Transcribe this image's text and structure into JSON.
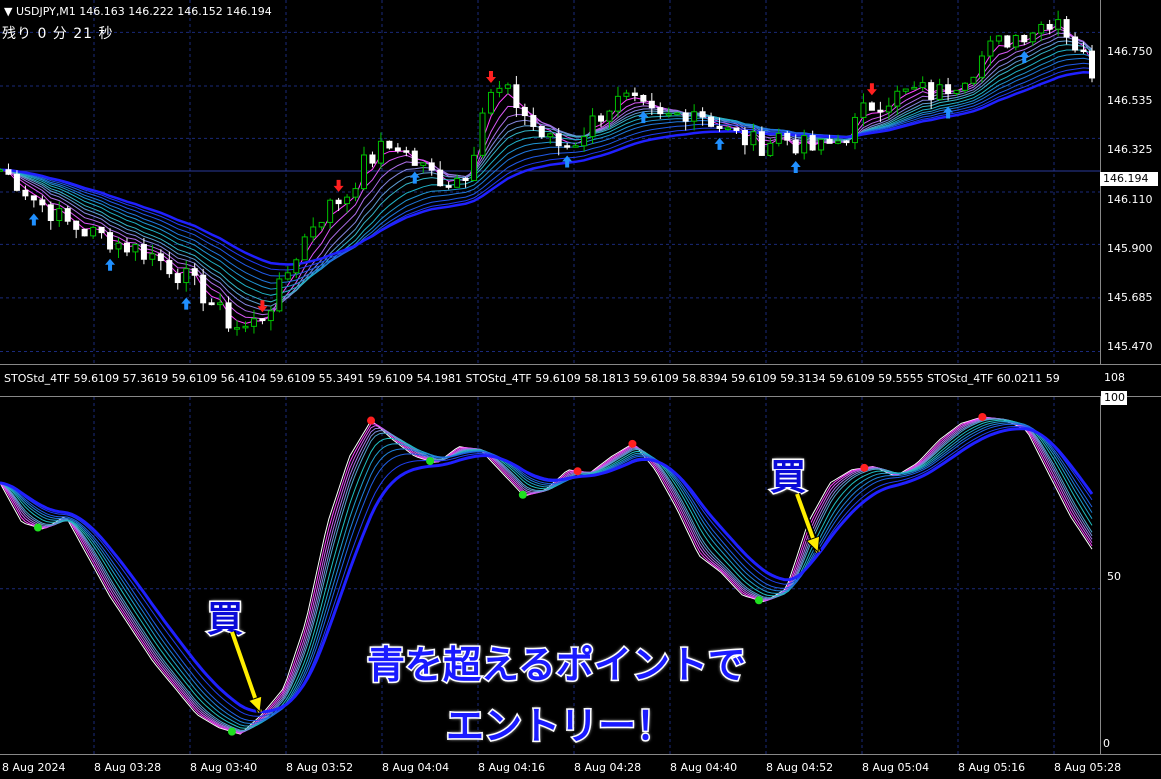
{
  "header": {
    "symbol_title": "▼ USDJPY,M1  146.163 146.222 146.152 146.194",
    "countdown": "残り 0 分 21 秒"
  },
  "price_axis": {
    "labels": [
      "146.750",
      "146.535",
      "146.325",
      "146.110",
      "145.900",
      "145.685",
      "145.470"
    ],
    "current_price": "146.194"
  },
  "indicator": {
    "info_text": "STOStd_4TF 59.6109 57.3619 59.6109 56.4104 59.6109 55.3491 59.6109 54.1981   STOStd_4TF 59.6109 58.1813 59.6109 58.8394 59.6109 59.3134 59.6109 59.5555   STOStd_4TF 60.0211 59",
    "level_108": "108",
    "level_100": "100",
    "level_50": "50",
    "level_0": "0"
  },
  "time_axis": {
    "labels": [
      "8 Aug 2024",
      "8 Aug 03:28",
      "8 Aug 03:40",
      "8 Aug 03:52",
      "8 Aug 04:04",
      "8 Aug 04:16",
      "8 Aug 04:28",
      "8 Aug 04:40",
      "8 Aug 04:52",
      "8 Aug 05:04",
      "8 Aug 05:16",
      "8 Aug 05:28"
    ]
  },
  "annotations": {
    "buy_1": "買",
    "buy_2": "買",
    "line1": "青を超えるポイントで",
    "line2": "エントリー！"
  },
  "colors": {
    "bull_candle": "#00c000",
    "bear_candle": "#ffffff",
    "grid": "#1a2a7a",
    "ribbon_fast": "#ff40ff",
    "ribbon_mid": "#20c0c0",
    "ribbon_slow": "#2020ff",
    "buy_arrow": "#2090ff",
    "sell_arrow": "#ff2020",
    "annotation_arrow": "#ffee00"
  },
  "chart_data": [
    {
      "type": "candlestick",
      "symbol": "USDJPY",
      "timeframe": "M1",
      "ylim": [
        145.42,
        146.88
      ],
      "last": 146.194,
      "ohlc_header": {
        "open": 146.163,
        "high": 146.222,
        "low": 146.152,
        "close": 146.194
      },
      "trend_y": [
        146.2,
        146.15,
        146.08,
        146.03,
        145.98,
        145.95,
        145.93,
        145.9,
        145.88,
        145.85,
        145.8,
        145.75,
        145.68,
        145.6,
        145.56,
        145.6,
        145.7,
        145.85,
        145.98,
        146.05,
        146.1,
        146.22,
        146.28,
        146.3,
        146.22,
        146.18,
        146.15,
        146.2,
        146.48,
        146.52,
        146.45,
        146.35,
        146.3,
        146.3,
        146.38,
        146.45,
        146.48,
        146.44,
        146.4,
        146.42,
        146.45,
        146.4,
        146.35,
        146.32,
        146.3,
        146.34,
        146.3,
        146.28,
        146.3,
        146.35,
        146.45,
        146.48,
        146.5,
        146.52,
        146.5,
        146.55,
        146.6,
        146.68,
        146.72,
        146.75,
        146.78,
        146.82,
        146.7,
        146.6
      ]
    },
    {
      "type": "line",
      "name": "STOStd_4TF",
      "ylim": [
        0,
        108
      ],
      "levels": [
        0,
        50,
        100
      ],
      "series_main": [
        82,
        70,
        68,
        72,
        60,
        48,
        38,
        28,
        20,
        12,
        8,
        6,
        12,
        20,
        40,
        70,
        90,
        101,
        95,
        90,
        88,
        93,
        92,
        85,
        78,
        80,
        86,
        85,
        90,
        94,
        86,
        74,
        60,
        55,
        48,
        46,
        50,
        70,
        82,
        86,
        87,
        84,
        88,
        95,
        100,
        102,
        101,
        98,
        85,
        72,
        62
      ]
    }
  ]
}
